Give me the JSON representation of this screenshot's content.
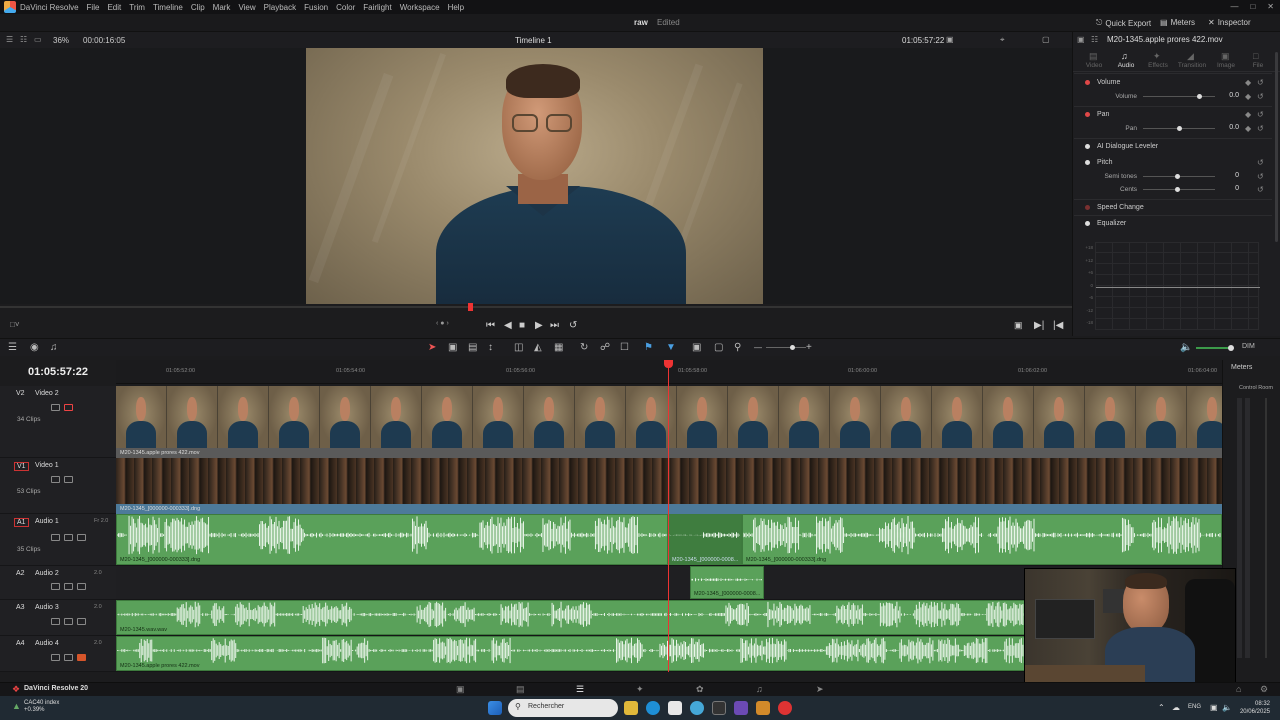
{
  "menubar": {
    "app": "DaVinci Resolve",
    "items": [
      "File",
      "Edit",
      "Trim",
      "Timeline",
      "Clip",
      "Mark",
      "View",
      "Playback",
      "Fusion",
      "Color",
      "Fairlight",
      "Workspace",
      "Help"
    ]
  },
  "titlebar": {
    "project": "raw",
    "status": "Edited",
    "quick_export": "Quick Export",
    "meters": "Meters",
    "inspector": "Inspector"
  },
  "viewer": {
    "zoom": "36%",
    "timecode_left": "00:00:16:05",
    "timeline_name": "Timeline 1",
    "timecode_right": "01:05:57:22"
  },
  "inspector": {
    "clip_name": "M20-1345.apple prores 422.mov",
    "tabs": [
      {
        "label": "Video",
        "icon": "film-icon",
        "active": false
      },
      {
        "label": "Audio",
        "icon": "music-note-icon",
        "active": true
      },
      {
        "label": "Effects",
        "icon": "effects-icon",
        "active": false
      },
      {
        "label": "Transition",
        "icon": "transition-icon",
        "active": false
      },
      {
        "label": "Image",
        "icon": "image-icon",
        "active": false
      },
      {
        "label": "File",
        "icon": "file-icon",
        "active": false
      }
    ],
    "sections": {
      "volume": {
        "title": "Volume",
        "param": "Volume",
        "value": "0.0",
        "level": 0.78
      },
      "pan": {
        "title": "Pan",
        "param": "Pan",
        "value": "0.0",
        "level": 0.5
      },
      "dialogue": {
        "title": "AI Dialogue Leveler"
      },
      "pitch": {
        "title": "Pitch",
        "semi_label": "Semi tones",
        "semi_value": "0",
        "cents_label": "Cents",
        "cents_value": "0"
      },
      "speed": {
        "title": "Speed Change"
      },
      "eq": {
        "title": "Equalizer"
      }
    },
    "eq_axis": [
      "+18",
      "+12",
      "+6",
      "0",
      "-6",
      "-12",
      "-18"
    ]
  },
  "timeline": {
    "timecode": "01:05:57:22",
    "ruler": [
      "01:05:52:00",
      "01:05:54:00",
      "01:05:56:00",
      "01:05:58:00",
      "01:06:00:00",
      "01:06:02:00",
      "01:06:04:00"
    ],
    "tracks": [
      {
        "id": "V2",
        "name": "Video 2",
        "count": "34 Clips"
      },
      {
        "id": "V1",
        "name": "Video 1",
        "count": "53 Clips"
      },
      {
        "id": "A1",
        "name": "Audio 1",
        "count": "35 Clips",
        "channels": "Fr 2.0"
      },
      {
        "id": "A2",
        "name": "Audio 2",
        "channels": "2.0"
      },
      {
        "id": "A3",
        "name": "Audio 3",
        "channels": "2.0"
      },
      {
        "id": "A4",
        "name": "Audio 4",
        "channels": "2.0"
      }
    ],
    "clips": {
      "v2": "M20-1345.apple prores 422.mov",
      "v1": "M20-1345_[000000-000333].dng",
      "a1a": "M20-1345_[000000-000333].dng",
      "a1b": "M20-1345_[000000-0008...",
      "a1c": "M20-1345_[000000-000333].dng",
      "a2": "M20-1345_[000000-0008...",
      "a3": "M20-1345.wav.wav",
      "a4": "M20-1345.apple prores 422.mov"
    }
  },
  "meters": {
    "title": "Meters",
    "control_room": "Control Room"
  },
  "pagebar": {
    "brand": "DaVinci Resolve 20",
    "pages": [
      "media-icon",
      "cut-icon",
      "edit-icon",
      "fusion-icon",
      "color-icon",
      "fairlight-icon",
      "deliver-icon"
    ]
  },
  "taskbar": {
    "stock_name": "CAC40 index",
    "stock_change": "+0.39%",
    "search_placeholder": "Rechercher",
    "lang": "ENG",
    "time": "08:32",
    "date": "20/06/2025"
  }
}
